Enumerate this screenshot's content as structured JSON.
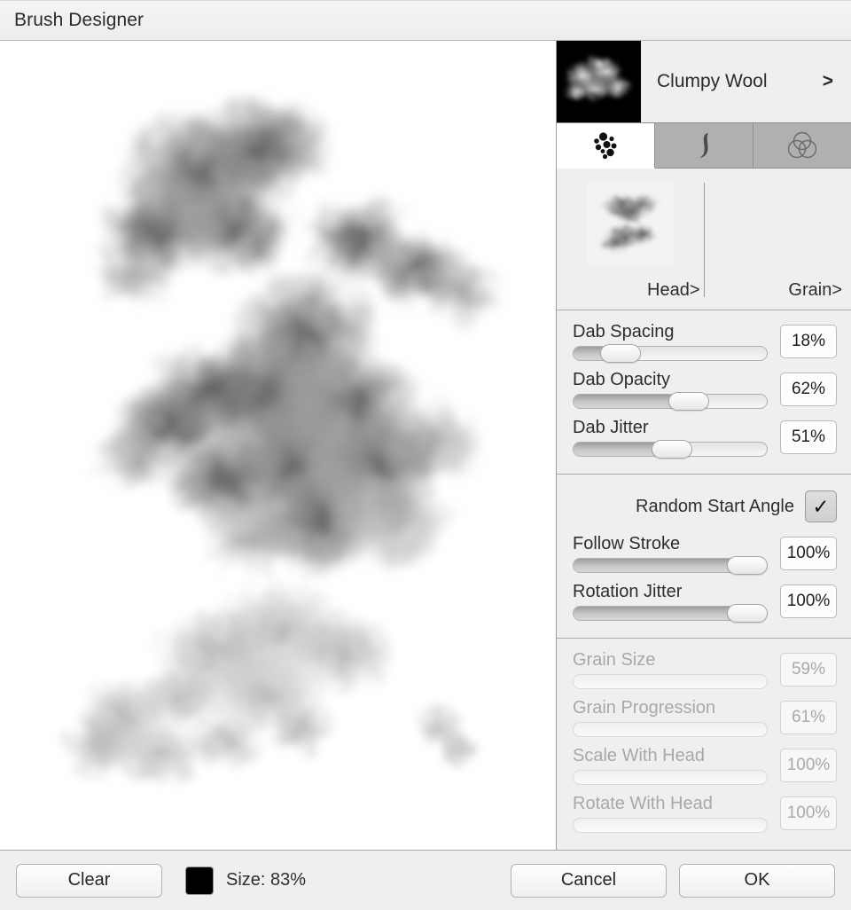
{
  "window": {
    "title": "Brush Designer"
  },
  "canvas": {
    "name": "brush-preview-canvas"
  },
  "brush": {
    "name": "Clumpy Wool",
    "chevron": ">",
    "thumbnail_icon": "brush-preview-thumbnail"
  },
  "tabs": [
    {
      "id": "dab",
      "icon": "dab-scatter-icon",
      "active": true
    },
    {
      "id": "stroke",
      "icon": "stroke-curve-icon",
      "active": false
    },
    {
      "id": "color",
      "icon": "color-circles-icon",
      "active": false
    }
  ],
  "head_grain": {
    "head_label": "Head>",
    "grain_label": "Grain>",
    "head_thumbnail_icon": "brush-head-thumbnail"
  },
  "groups": [
    {
      "id": "dab-group",
      "disabled": false,
      "controls": [
        {
          "label": "Dab Spacing",
          "value": "18%",
          "percent": 18
        },
        {
          "label": "Dab Opacity",
          "value": "62%",
          "percent": 62
        },
        {
          "label": "Dab Jitter",
          "value": "51%",
          "percent": 51
        }
      ]
    },
    {
      "id": "angle-group",
      "disabled": false,
      "checkbox": {
        "label": "Random Start Angle",
        "checked": true,
        "mark": "✓"
      },
      "controls": [
        {
          "label": "Follow Stroke",
          "value": "100%",
          "percent": 100
        },
        {
          "label": "Rotation Jitter",
          "value": "100%",
          "percent": 100
        }
      ]
    },
    {
      "id": "grain-group",
      "disabled": true,
      "controls": [
        {
          "label": "Grain Size",
          "value": "59%",
          "percent": 59
        },
        {
          "label": "Grain Progression",
          "value": "61%",
          "percent": 61
        },
        {
          "label": "Scale With Head",
          "value": "100%",
          "percent": 100
        },
        {
          "label": "Rotate With Head",
          "value": "100%",
          "percent": 100
        }
      ]
    }
  ],
  "bottom": {
    "clear_label": "Clear",
    "color_swatch": "#000000",
    "size_label": "Size: 83%",
    "cancel_label": "Cancel",
    "ok_label": "OK"
  },
  "colors": {
    "panel_bg": "#efefef",
    "canvas_bg": "#ffffff",
    "tab_inactive": "#b0b0b0",
    "tab_active": "#ffffff",
    "text": "#2e2e2e",
    "disabled_text": "#a8a8a8"
  }
}
